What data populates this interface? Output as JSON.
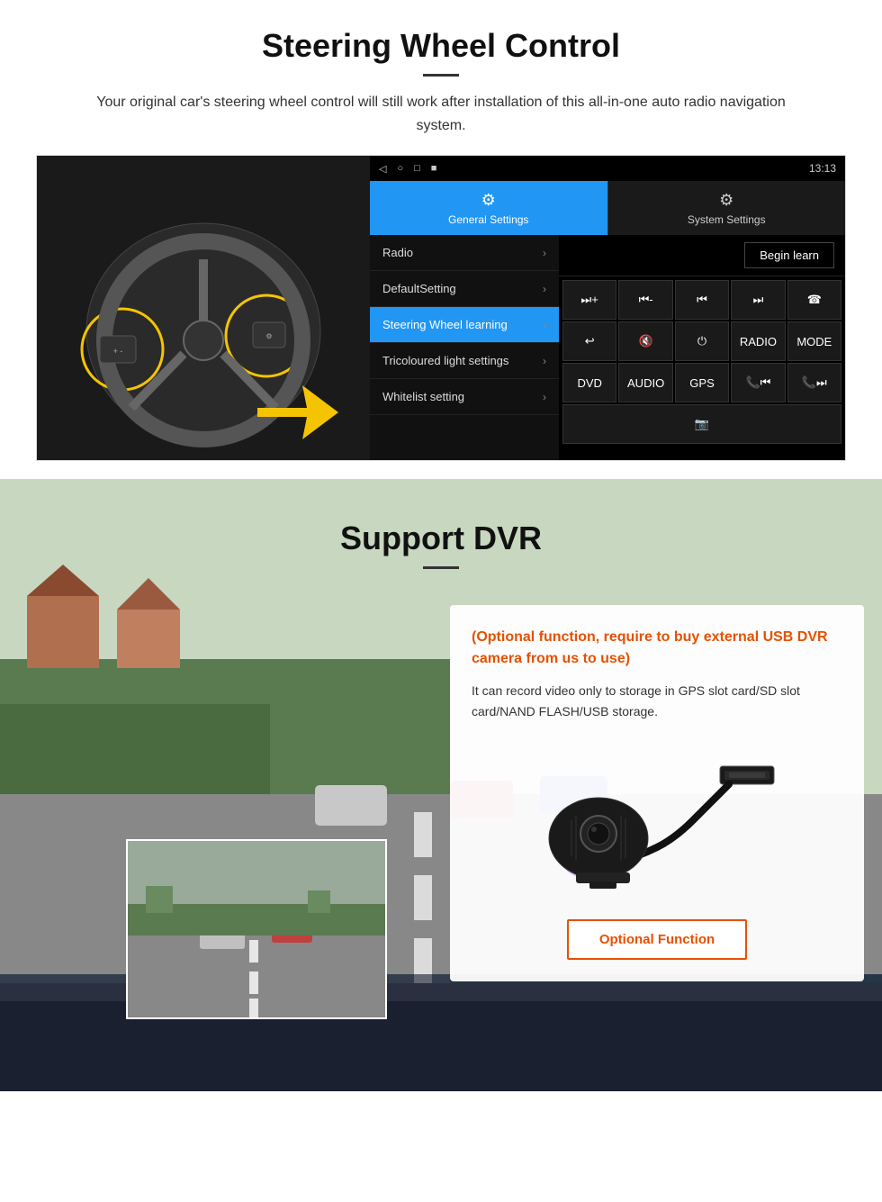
{
  "page": {
    "steering_section": {
      "title": "Steering Wheel Control",
      "subtitle": "Your original car's steering wheel control will still work after installation of this all-in-one auto radio navigation system.",
      "android_ui": {
        "statusbar": {
          "icons": [
            "◁",
            "○",
            "□",
            "■"
          ],
          "time": "13:13",
          "signal": "▼"
        },
        "tabs": {
          "general_settings": {
            "label": "General Settings",
            "icon": "⚙",
            "active": true
          },
          "system_settings": {
            "label": "System Settings",
            "icon": "🔧",
            "active": false
          }
        },
        "menu_items": [
          {
            "label": "Radio",
            "active": false
          },
          {
            "label": "DefaultSetting",
            "active": false
          },
          {
            "label": "Steering Wheel learning",
            "active": true
          },
          {
            "label": "Tricoloured light settings",
            "active": false
          },
          {
            "label": "Whitelist setting",
            "active": false
          }
        ],
        "begin_learn_btn": "Begin learn",
        "control_buttons": [
          [
            "⏮+",
            "⏮-",
            "⏮",
            "⏭",
            "☎"
          ],
          [
            "↩",
            "🔇",
            "⏻",
            "RADIO",
            "MODE"
          ],
          [
            "DVD",
            "AUDIO",
            "GPS",
            "📞⏮",
            "📞⏭"
          ],
          [
            "📷"
          ]
        ]
      }
    },
    "dvr_section": {
      "title": "Support DVR",
      "info_card": {
        "optional_text": "(Optional function, require to buy external USB DVR camera from us to use)",
        "description": "It can record video only to storage in GPS slot card/SD slot card/NAND FLASH/USB storage.",
        "optional_function_btn": "Optional Function"
      }
    }
  }
}
